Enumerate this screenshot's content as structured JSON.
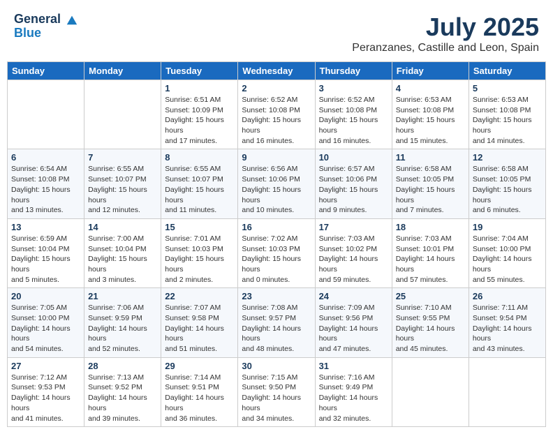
{
  "header": {
    "logo_line1": "General",
    "logo_line2": "Blue",
    "month_title": "July 2025",
    "location": "Peranzanes, Castille and Leon, Spain"
  },
  "weekdays": [
    "Sunday",
    "Monday",
    "Tuesday",
    "Wednesday",
    "Thursday",
    "Friday",
    "Saturday"
  ],
  "weeks": [
    [
      null,
      null,
      {
        "day": 1,
        "sunrise": "6:51 AM",
        "sunset": "10:09 PM",
        "daylight": "15 hours and 17 minutes."
      },
      {
        "day": 2,
        "sunrise": "6:52 AM",
        "sunset": "10:08 PM",
        "daylight": "15 hours and 16 minutes."
      },
      {
        "day": 3,
        "sunrise": "6:52 AM",
        "sunset": "10:08 PM",
        "daylight": "15 hours and 16 minutes."
      },
      {
        "day": 4,
        "sunrise": "6:53 AM",
        "sunset": "10:08 PM",
        "daylight": "15 hours and 15 minutes."
      },
      {
        "day": 5,
        "sunrise": "6:53 AM",
        "sunset": "10:08 PM",
        "daylight": "15 hours and 14 minutes."
      }
    ],
    [
      {
        "day": 6,
        "sunrise": "6:54 AM",
        "sunset": "10:08 PM",
        "daylight": "15 hours and 13 minutes."
      },
      {
        "day": 7,
        "sunrise": "6:55 AM",
        "sunset": "10:07 PM",
        "daylight": "15 hours and 12 minutes."
      },
      {
        "day": 8,
        "sunrise": "6:55 AM",
        "sunset": "10:07 PM",
        "daylight": "15 hours and 11 minutes."
      },
      {
        "day": 9,
        "sunrise": "6:56 AM",
        "sunset": "10:06 PM",
        "daylight": "15 hours and 10 minutes."
      },
      {
        "day": 10,
        "sunrise": "6:57 AM",
        "sunset": "10:06 PM",
        "daylight": "15 hours and 9 minutes."
      },
      {
        "day": 11,
        "sunrise": "6:58 AM",
        "sunset": "10:05 PM",
        "daylight": "15 hours and 7 minutes."
      },
      {
        "day": 12,
        "sunrise": "6:58 AM",
        "sunset": "10:05 PM",
        "daylight": "15 hours and 6 minutes."
      }
    ],
    [
      {
        "day": 13,
        "sunrise": "6:59 AM",
        "sunset": "10:04 PM",
        "daylight": "15 hours and 5 minutes."
      },
      {
        "day": 14,
        "sunrise": "7:00 AM",
        "sunset": "10:04 PM",
        "daylight": "15 hours and 3 minutes."
      },
      {
        "day": 15,
        "sunrise": "7:01 AM",
        "sunset": "10:03 PM",
        "daylight": "15 hours and 2 minutes."
      },
      {
        "day": 16,
        "sunrise": "7:02 AM",
        "sunset": "10:03 PM",
        "daylight": "15 hours and 0 minutes."
      },
      {
        "day": 17,
        "sunrise": "7:03 AM",
        "sunset": "10:02 PM",
        "daylight": "14 hours and 59 minutes."
      },
      {
        "day": 18,
        "sunrise": "7:03 AM",
        "sunset": "10:01 PM",
        "daylight": "14 hours and 57 minutes."
      },
      {
        "day": 19,
        "sunrise": "7:04 AM",
        "sunset": "10:00 PM",
        "daylight": "14 hours and 55 minutes."
      }
    ],
    [
      {
        "day": 20,
        "sunrise": "7:05 AM",
        "sunset": "10:00 PM",
        "daylight": "14 hours and 54 minutes."
      },
      {
        "day": 21,
        "sunrise": "7:06 AM",
        "sunset": "9:59 PM",
        "daylight": "14 hours and 52 minutes."
      },
      {
        "day": 22,
        "sunrise": "7:07 AM",
        "sunset": "9:58 PM",
        "daylight": "14 hours and 51 minutes."
      },
      {
        "day": 23,
        "sunrise": "7:08 AM",
        "sunset": "9:57 PM",
        "daylight": "14 hours and 48 minutes."
      },
      {
        "day": 24,
        "sunrise": "7:09 AM",
        "sunset": "9:56 PM",
        "daylight": "14 hours and 47 minutes."
      },
      {
        "day": 25,
        "sunrise": "7:10 AM",
        "sunset": "9:55 PM",
        "daylight": "14 hours and 45 minutes."
      },
      {
        "day": 26,
        "sunrise": "7:11 AM",
        "sunset": "9:54 PM",
        "daylight": "14 hours and 43 minutes."
      }
    ],
    [
      {
        "day": 27,
        "sunrise": "7:12 AM",
        "sunset": "9:53 PM",
        "daylight": "14 hours and 41 minutes."
      },
      {
        "day": 28,
        "sunrise": "7:13 AM",
        "sunset": "9:52 PM",
        "daylight": "14 hours and 39 minutes."
      },
      {
        "day": 29,
        "sunrise": "7:14 AM",
        "sunset": "9:51 PM",
        "daylight": "14 hours and 36 minutes."
      },
      {
        "day": 30,
        "sunrise": "7:15 AM",
        "sunset": "9:50 PM",
        "daylight": "14 hours and 34 minutes."
      },
      {
        "day": 31,
        "sunrise": "7:16 AM",
        "sunset": "9:49 PM",
        "daylight": "14 hours and 32 minutes."
      },
      null,
      null
    ]
  ]
}
